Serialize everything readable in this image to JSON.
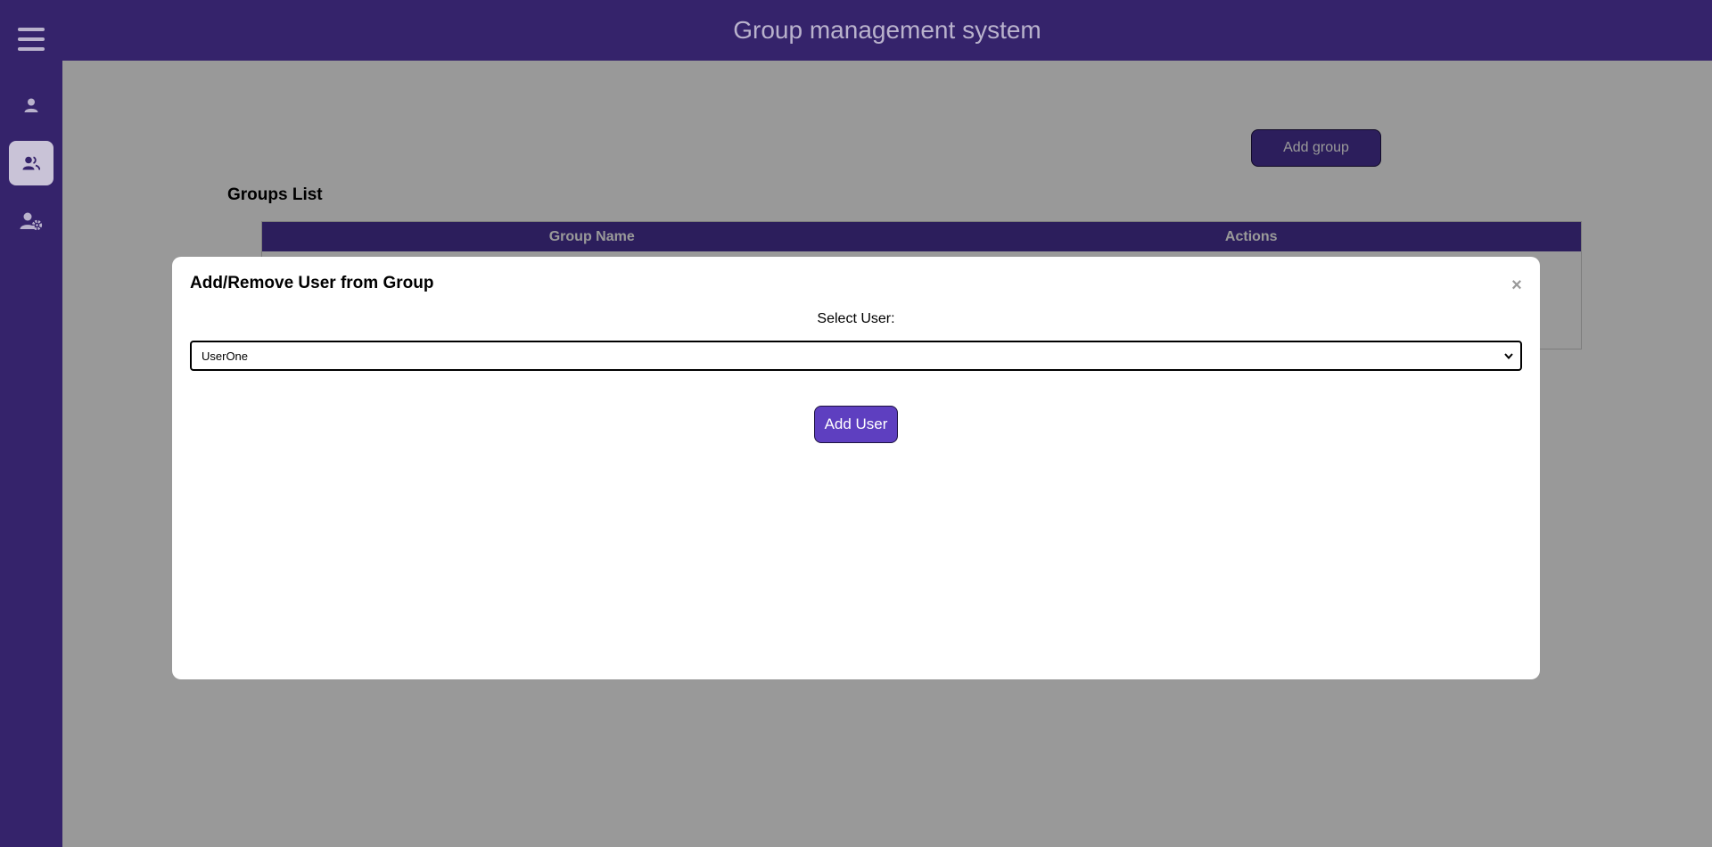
{
  "header": {
    "title": "Group management system"
  },
  "sidebar": {
    "items": [
      {
        "icon": "user-icon"
      },
      {
        "icon": "group-icon",
        "active": true
      },
      {
        "icon": "user-settings-icon"
      }
    ]
  },
  "main": {
    "add_group_label": "Add group",
    "groups_title": "Groups List",
    "table": {
      "columns": [
        "Group Name",
        "Actions"
      ]
    }
  },
  "modal": {
    "title": "Add/Remove User from Group",
    "close_symbol": "×",
    "select_label": "Select User:",
    "selected_user": "UserOne",
    "add_user_label": "Add User"
  },
  "colors": {
    "primary": "#35236b",
    "button": "#4a3399",
    "modal_button": "#5e3fc0",
    "overlay": "rgba(0,0,0,0.4)"
  }
}
